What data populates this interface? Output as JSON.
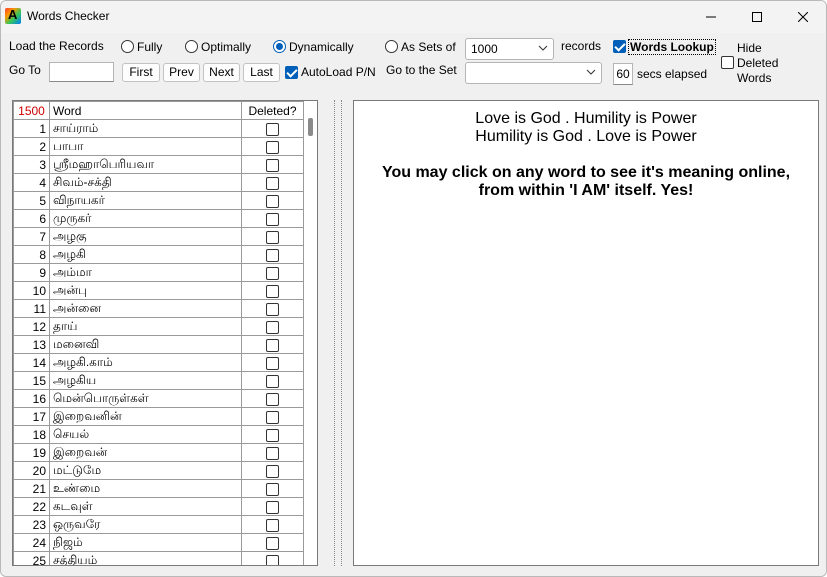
{
  "window": {
    "title": "Words Checker",
    "app_icon_letter": "A"
  },
  "load": {
    "label": "Load the Records",
    "options": [
      {
        "label": "Fully",
        "selected": false
      },
      {
        "label": "Optimally",
        "selected": false
      },
      {
        "label": "Dynamically",
        "selected": true
      },
      {
        "label": "As Sets of",
        "selected": false
      }
    ],
    "set_size": "1000",
    "records_label": "records"
  },
  "goto": {
    "label": "Go To",
    "value": "",
    "buttons": {
      "first": "First",
      "prev": "Prev",
      "next": "Next",
      "last": "Last"
    },
    "autoload_label": "AutoLoad P/N",
    "autoload_checked": true,
    "goto_set_label": "Go to the Set",
    "goto_set_value": ""
  },
  "lookup": {
    "label": "Words Lookup",
    "checked": true
  },
  "timer": {
    "value": "60",
    "label": "secs elapsed"
  },
  "hide_deleted": {
    "label_line1": "Hide",
    "label_line2": "Deleted",
    "label_line3": "Words",
    "checked": false
  },
  "grid": {
    "count": "1500",
    "col_word": "Word",
    "col_deleted": "Deleted?",
    "rows": [
      {
        "n": "1",
        "word": "சாய்ராம்",
        "deleted": false
      },
      {
        "n": "2",
        "word": "பாபா",
        "deleted": false
      },
      {
        "n": "3",
        "word": "ஸ்ரீமஹாபெரியவா",
        "deleted": false
      },
      {
        "n": "4",
        "word": "சிவம்-சக்தி",
        "deleted": false
      },
      {
        "n": "5",
        "word": "விநாயகர்",
        "deleted": false
      },
      {
        "n": "6",
        "word": "முருகர்",
        "deleted": false
      },
      {
        "n": "7",
        "word": "அழகு",
        "deleted": false
      },
      {
        "n": "8",
        "word": "அழகி",
        "deleted": false
      },
      {
        "n": "9",
        "word": "அம்மா",
        "deleted": false
      },
      {
        "n": "10",
        "word": "அன்பு",
        "deleted": false
      },
      {
        "n": "11",
        "word": "அன்னை",
        "deleted": false
      },
      {
        "n": "12",
        "word": "தாய்",
        "deleted": false
      },
      {
        "n": "13",
        "word": "மனைவி",
        "deleted": false
      },
      {
        "n": "14",
        "word": "அழகி.காம்",
        "deleted": false
      },
      {
        "n": "15",
        "word": "அழகிய",
        "deleted": false
      },
      {
        "n": "16",
        "word": "மென்பொருள்கள்",
        "deleted": false
      },
      {
        "n": "17",
        "word": "இறைவனின்",
        "deleted": false
      },
      {
        "n": "18",
        "word": "செயல்",
        "deleted": false
      },
      {
        "n": "19",
        "word": "இறைவன்",
        "deleted": false
      },
      {
        "n": "20",
        "word": "மட்டுமே",
        "deleted": false
      },
      {
        "n": "21",
        "word": "உண்மை",
        "deleted": false
      },
      {
        "n": "22",
        "word": "கடவுள்",
        "deleted": false
      },
      {
        "n": "23",
        "word": "ஒருவரே",
        "deleted": false
      },
      {
        "n": "24",
        "word": "நிஜம்",
        "deleted": false
      },
      {
        "n": "25",
        "word": "சத்தியம்",
        "deleted": false
      }
    ]
  },
  "message": {
    "line1": "Love is God . Humility is Power",
    "line2": "Humility is God . Love is Power",
    "line3": "You may click on any word to see it's meaning online,",
    "line4": "from within 'I AM' itself. Yes!"
  },
  "colors": {
    "accent": "#005fb8",
    "count": "#d00000"
  },
  "icons": [
    "minimize-icon",
    "maximize-icon",
    "close-icon",
    "chevron-down-icon"
  ]
}
